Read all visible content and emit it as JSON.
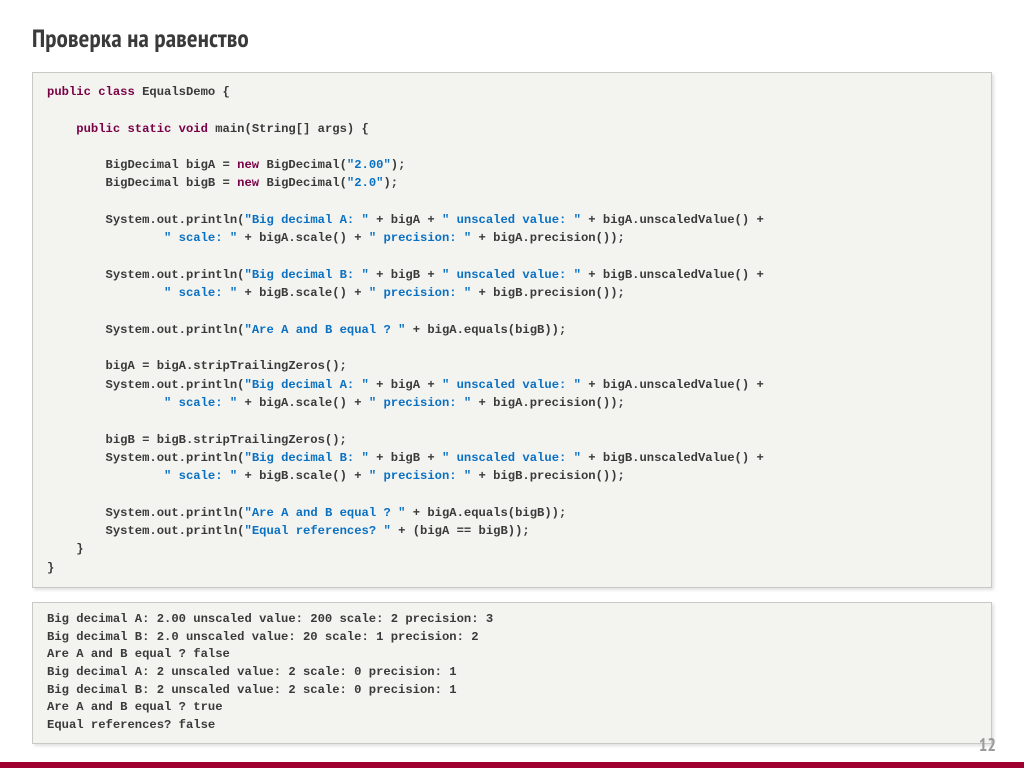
{
  "title": "Проверка на равенство",
  "page_number": "12",
  "code": {
    "l01_kw1": "public class ",
    "l01_cls": "EqualsDemo",
    "l01_rest": " {",
    "l02": "",
    "l03_pad": "    ",
    "l03_kw": "public static void ",
    "l03_name": "main",
    "l03_args": "(String[] args) {",
    "l04": "",
    "l05_pad": "        ",
    "l05_a": "BigDecimal bigA = ",
    "l05_kw": "new ",
    "l05_b": "BigDecimal(",
    "l05_str": "\"2.00\"",
    "l05_c": ");",
    "l06_pad": "        ",
    "l06_a": "BigDecimal bigB = ",
    "l06_kw": "new ",
    "l06_b": "BigDecimal(",
    "l06_str": "\"2.0\"",
    "l06_c": ");",
    "l07": "",
    "l08_pad": "        ",
    "l08_a": "System.",
    "l08_out": "out",
    "l08_b": ".println(",
    "l08_s1": "\"Big decimal A: \"",
    "l08_c": " + bigA + ",
    "l08_s2": "\" unscaled value: \"",
    "l08_d": " + bigA.unscaledValue() +",
    "l09_pad": "                ",
    "l09_s1": "\" scale: \"",
    "l09_a": " + bigA.scale() + ",
    "l09_s2": "\" precision: \"",
    "l09_b": " + bigA.precision());",
    "l10": "",
    "l11_pad": "        ",
    "l11_a": "System.",
    "l11_out": "out",
    "l11_b": ".println(",
    "l11_s1": "\"Big decimal B: \"",
    "l11_c": " + bigB + ",
    "l11_s2": "\" unscaled value: \"",
    "l11_d": " + bigB.unscaledValue() +",
    "l12_pad": "                ",
    "l12_s1": "\" scale: \"",
    "l12_a": " + bigB.scale() + ",
    "l12_s2": "\" precision: \"",
    "l12_b": " + bigB.precision());",
    "l13": "",
    "l14_pad": "        ",
    "l14_a": "System.",
    "l14_out": "out",
    "l14_b": ".println(",
    "l14_s1": "\"Are A and B equal ? \"",
    "l14_c": " + bigA.equals(bigB));",
    "l15": "",
    "l16_pad": "        ",
    "l16_a": "bigA = bigA.stripTrailingZeros();",
    "l17_pad": "        ",
    "l17_a": "System.",
    "l17_out": "out",
    "l17_b": ".println(",
    "l17_s1": "\"Big decimal A: \"",
    "l17_c": " + bigA + ",
    "l17_s2": "\" unscaled value: \"",
    "l17_d": " + bigA.unscaledValue() +",
    "l18_pad": "                ",
    "l18_s1": "\" scale: \"",
    "l18_a": " + bigA.scale() + ",
    "l18_s2": "\" precision: \"",
    "l18_b": " + bigA.precision());",
    "l19": "",
    "l20_pad": "        ",
    "l20_a": "bigB = bigB.stripTrailingZeros();",
    "l21_pad": "        ",
    "l21_a": "System.",
    "l21_out": "out",
    "l21_b": ".println(",
    "l21_s1": "\"Big decimal B: \"",
    "l21_c": " + bigB + ",
    "l21_s2": "\" unscaled value: \"",
    "l21_d": " + bigB.unscaledValue() +",
    "l22_pad": "                ",
    "l22_s1": "\" scale: \"",
    "l22_a": " + bigB.scale() + ",
    "l22_s2": "\" precision: \"",
    "l22_b": " + bigB.precision());",
    "l23": "",
    "l24_pad": "        ",
    "l24_a": "System.",
    "l24_out": "out",
    "l24_b": ".println(",
    "l24_s1": "\"Are A and B equal ? \"",
    "l24_c": " + bigA.equals(bigB));",
    "l25_pad": "        ",
    "l25_a": "System.",
    "l25_out": "out",
    "l25_b": ".println(",
    "l25_s1": "\"Equal references? \"",
    "l25_c": " + (bigA == bigB));",
    "l26_pad": "    ",
    "l26_a": "}",
    "l27_a": "}"
  },
  "output": [
    "Big decimal A: 2.00 unscaled value: 200 scale: 2 precision: 3",
    "Big decimal B: 2.0 unscaled value: 20 scale: 1 precision: 2",
    "Are A and B equal ? false",
    "Big decimal A: 2 unscaled value: 2 scale: 0 precision: 1",
    "Big decimal B: 2 unscaled value: 2 scale: 0 precision: 1",
    "Are A and B equal ? true",
    "Equal references? false"
  ]
}
